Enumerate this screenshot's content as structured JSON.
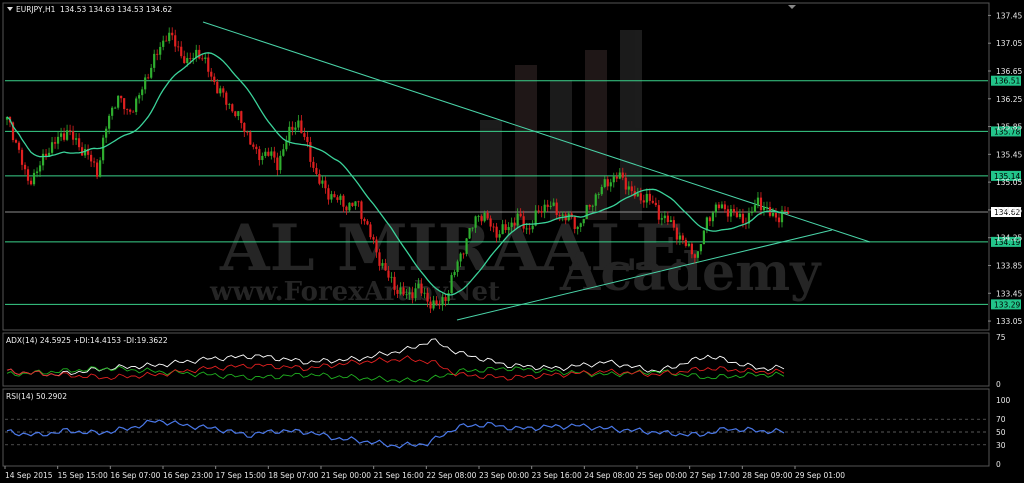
{
  "main_header": {
    "symbol": "EURJPY,H1",
    "ohlc": "134.53 134.63 134.53 134.62"
  },
  "adx_header": "ADX(14) 24.5925 +DI:14.4153 -DI:19.3622",
  "rsi_header": "RSI(14) 50.2902",
  "watermark": {
    "brand": "AL MIRAALE",
    "sub": "Academy",
    "url": "www.ForexArabyNet"
  },
  "colors": {
    "background": "#000000",
    "bull_candle": "#2fae2f",
    "bear_candle": "#e02020",
    "ma": "#3bd39a",
    "trendline": "#4ad4a8",
    "level_line": "#3ad18a",
    "level_box": "#22c48a",
    "current_price_box": "#ffffff",
    "adx_main": "#ffffff",
    "plus_di": "#20b020",
    "minus_di": "#e02020",
    "rsi": "#4a78e8"
  },
  "chart_data": {
    "type": "candlestick",
    "symbol": "EURJPY",
    "timeframe": "H1",
    "y_ticks": [
      "137.45",
      "137.05",
      "136.65",
      "136.25",
      "135.85",
      "135.45",
      "135.05",
      "134.65",
      "134.25",
      "133.85",
      "133.45",
      "133.05"
    ],
    "y_range": [
      132.95,
      137.6
    ],
    "x_labels": [
      "14 Sep 2015",
      "15 Sep 15:00",
      "16 Sep 07:00",
      "16 Sep 23:00",
      "17 Sep 15:00",
      "18 Sep 07:00",
      "21 Sep 00:00",
      "21 Sep 16:00",
      "22 Sep 08:00",
      "23 Sep 00:00",
      "23 Sep 16:00",
      "24 Sep 08:00",
      "25 Sep 00:00",
      "27 Sep 17:00",
      "28 Sep 09:00",
      "29 Sep 01:00"
    ],
    "horizontal_levels": [
      "136.51",
      "135.78",
      "135.14",
      "134.19",
      "133.29"
    ],
    "current_price": "134.62",
    "price_path": [
      {
        "x": 0,
        "p": 135.95
      },
      {
        "x": 2,
        "p": 135.6
      },
      {
        "x": 4,
        "p": 135.05
      },
      {
        "x": 6,
        "p": 135.2
      },
      {
        "x": 8,
        "p": 135.5
      },
      {
        "x": 10,
        "p": 135.65
      },
      {
        "x": 12,
        "p": 135.8
      },
      {
        "x": 14,
        "p": 135.6
      },
      {
        "x": 16,
        "p": 135.45
      },
      {
        "x": 18,
        "p": 135.2
      },
      {
        "x": 20,
        "p": 135.9
      },
      {
        "x": 22,
        "p": 136.3
      },
      {
        "x": 24,
        "p": 136.05
      },
      {
        "x": 26,
        "p": 136.2
      },
      {
        "x": 28,
        "p": 136.6
      },
      {
        "x": 30,
        "p": 136.9
      },
      {
        "x": 32,
        "p": 137.2
      },
      {
        "x": 34,
        "p": 137.0
      },
      {
        "x": 36,
        "p": 136.75
      },
      {
        "x": 38,
        "p": 136.95
      },
      {
        "x": 40,
        "p": 136.7
      },
      {
        "x": 42,
        "p": 136.4
      },
      {
        "x": 44,
        "p": 136.2
      },
      {
        "x": 46,
        "p": 136.0
      },
      {
        "x": 48,
        "p": 135.75
      },
      {
        "x": 50,
        "p": 135.4
      },
      {
        "x": 52,
        "p": 135.5
      },
      {
        "x": 54,
        "p": 135.3
      },
      {
        "x": 56,
        "p": 135.7
      },
      {
        "x": 58,
        "p": 135.95
      },
      {
        "x": 60,
        "p": 135.55
      },
      {
        "x": 62,
        "p": 135.1
      },
      {
        "x": 64,
        "p": 134.9
      },
      {
        "x": 66,
        "p": 134.8
      },
      {
        "x": 68,
        "p": 134.7
      },
      {
        "x": 70,
        "p": 134.75
      },
      {
        "x": 72,
        "p": 134.4
      },
      {
        "x": 74,
        "p": 134.0
      },
      {
        "x": 76,
        "p": 133.7
      },
      {
        "x": 78,
        "p": 133.5
      },
      {
        "x": 80,
        "p": 133.4
      },
      {
        "x": 82,
        "p": 133.55
      },
      {
        "x": 84,
        "p": 133.35
      },
      {
        "x": 86,
        "p": 133.25
      },
      {
        "x": 88,
        "p": 133.45
      },
      {
        "x": 90,
        "p": 133.9
      },
      {
        "x": 92,
        "p": 134.25
      },
      {
        "x": 94,
        "p": 134.6
      },
      {
        "x": 96,
        "p": 134.5
      },
      {
        "x": 98,
        "p": 134.3
      },
      {
        "x": 100,
        "p": 134.4
      },
      {
        "x": 102,
        "p": 134.55
      },
      {
        "x": 104,
        "p": 134.35
      },
      {
        "x": 106,
        "p": 134.6
      },
      {
        "x": 108,
        "p": 134.75
      },
      {
        "x": 110,
        "p": 134.6
      },
      {
        "x": 112,
        "p": 134.55
      },
      {
        "x": 114,
        "p": 134.4
      },
      {
        "x": 116,
        "p": 134.65
      },
      {
        "x": 118,
        "p": 134.9
      },
      {
        "x": 120,
        "p": 135.05
      },
      {
        "x": 122,
        "p": 135.15
      },
      {
        "x": 124,
        "p": 135.0
      },
      {
        "x": 126,
        "p": 134.8
      },
      {
        "x": 128,
        "p": 134.85
      },
      {
        "x": 130,
        "p": 134.6
      },
      {
        "x": 132,
        "p": 134.5
      },
      {
        "x": 134,
        "p": 134.3
      },
      {
        "x": 136,
        "p": 134.1
      },
      {
        "x": 138,
        "p": 134.0
      },
      {
        "x": 140,
        "p": 134.55
      },
      {
        "x": 142,
        "p": 134.7
      },
      {
        "x": 144,
        "p": 134.65
      },
      {
        "x": 146,
        "p": 134.55
      },
      {
        "x": 148,
        "p": 134.5
      },
      {
        "x": 150,
        "p": 134.8
      },
      {
        "x": 152,
        "p": 134.6
      },
      {
        "x": 154,
        "p": 134.55
      },
      {
        "x": 156,
        "p": 134.62
      }
    ],
    "adx_range": [
      0,
      75
    ],
    "adx_ticks": [
      "75",
      "0"
    ],
    "adx": {
      "x": [
        0,
        10,
        20,
        30,
        40,
        50,
        60,
        70,
        80,
        85,
        90,
        100,
        110,
        120,
        130,
        140,
        150,
        156
      ],
      "adx": [
        20,
        15,
        25,
        30,
        40,
        45,
        35,
        40,
        55,
        70,
        50,
        30,
        25,
        35,
        20,
        45,
        25,
        26
      ],
      "plus_di": [
        15,
        20,
        25,
        20,
        15,
        10,
        15,
        10,
        5,
        8,
        20,
        25,
        20,
        15,
        20,
        10,
        15,
        14
      ],
      "minus_di": [
        20,
        15,
        10,
        15,
        25,
        30,
        25,
        35,
        40,
        35,
        15,
        10,
        15,
        20,
        15,
        25,
        20,
        19
      ]
    },
    "rsi_range": [
      0,
      100
    ],
    "rsi_ticks": [
      "100",
      "70",
      "50",
      "30",
      "0"
    ],
    "rsi": {
      "x": [
        0,
        6,
        12,
        18,
        24,
        30,
        36,
        42,
        48,
        54,
        60,
        66,
        72,
        78,
        84,
        90,
        96,
        102,
        108,
        114,
        120,
        126,
        132,
        138,
        144,
        150,
        156
      ],
      "values": [
        50,
        45,
        52,
        48,
        55,
        68,
        60,
        55,
        45,
        52,
        50,
        40,
        35,
        28,
        32,
        58,
        62,
        55,
        58,
        60,
        55,
        52,
        48,
        45,
        55,
        52,
        50
      ]
    }
  }
}
